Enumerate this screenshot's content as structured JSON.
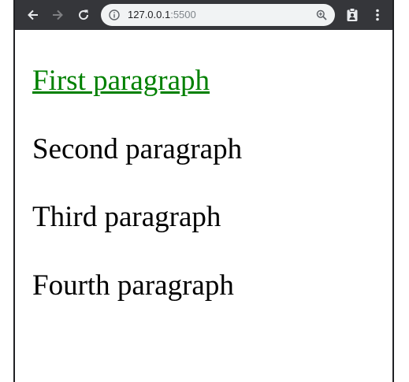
{
  "browser": {
    "url_host": "127.0.0.1",
    "url_port": ":5500",
    "toolbar_color": "#35363a",
    "omnibox_color": "#f1f3f4"
  },
  "icons": {
    "back": "back-arrow-icon",
    "forward": "forward-arrow-icon",
    "reload": "reload-icon",
    "info": "info-icon",
    "zoom": "zoom-icon",
    "extension": "clipboard-extension-icon",
    "menu": "kebab-menu-icon"
  },
  "page": {
    "paragraphs": [
      {
        "text": "First paragraph",
        "color": "#008000",
        "underline": true
      },
      {
        "text": "Second paragraph",
        "color": "#000000"
      },
      {
        "text": "Third paragraph",
        "color": "#000000"
      },
      {
        "text": "Fourth paragraph",
        "color": "#000000"
      }
    ]
  }
}
